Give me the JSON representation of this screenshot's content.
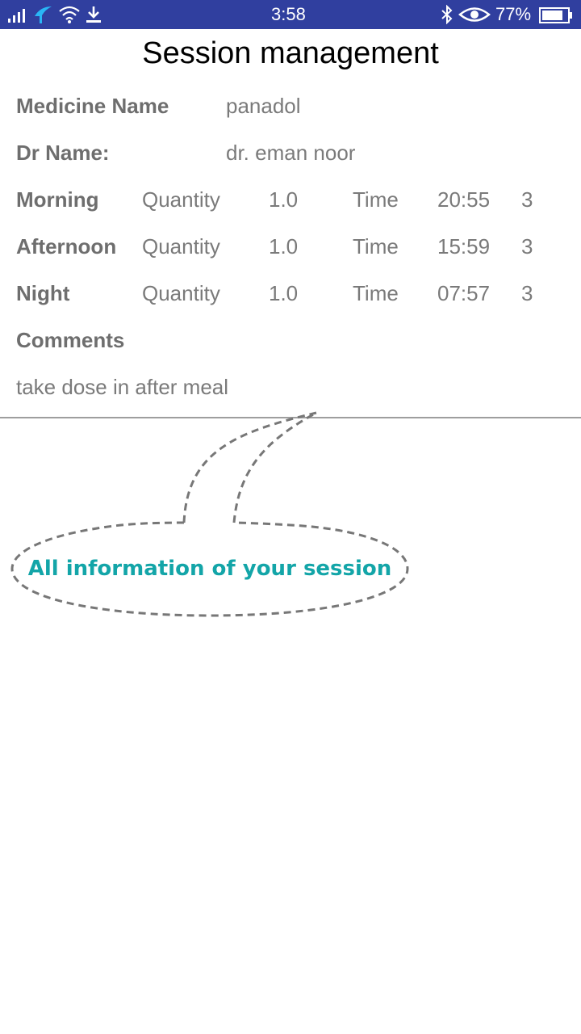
{
  "status_bar": {
    "time": "3:58",
    "battery": "77%",
    "icons": [
      "signal-icon",
      "carrier-icon",
      "wifi-icon",
      "download-icon",
      "bluetooth-icon",
      "eye-icon",
      "battery-icon"
    ]
  },
  "title": "Session management",
  "medicine": {
    "label": "Medicine Name",
    "value": "panadol"
  },
  "doctor": {
    "label": "Dr Name:",
    "value": "dr. eman noor"
  },
  "doses": [
    {
      "period": "Morning",
      "quantity_label": "Quantity",
      "quantity": "1.0",
      "time_label": "Time",
      "time": "20:55",
      "count": "3"
    },
    {
      "period": "Afternoon",
      "quantity_label": "Quantity",
      "quantity": "1.0",
      "time_label": "Time",
      "time": "15:59",
      "count": "3"
    },
    {
      "period": "Night",
      "quantity_label": "Quantity",
      "quantity": "1.0",
      "time_label": "Time",
      "time": "07:57",
      "count": "3"
    }
  ],
  "comments": {
    "label": "Comments",
    "value": "take dose in after meal"
  },
  "callout": {
    "text": "All information of your session"
  },
  "colors": {
    "status_bar": "#303f9f",
    "callout_text": "#13a5a8",
    "label_text": "#6e6e6e",
    "value_text": "#7a7a7a"
  }
}
